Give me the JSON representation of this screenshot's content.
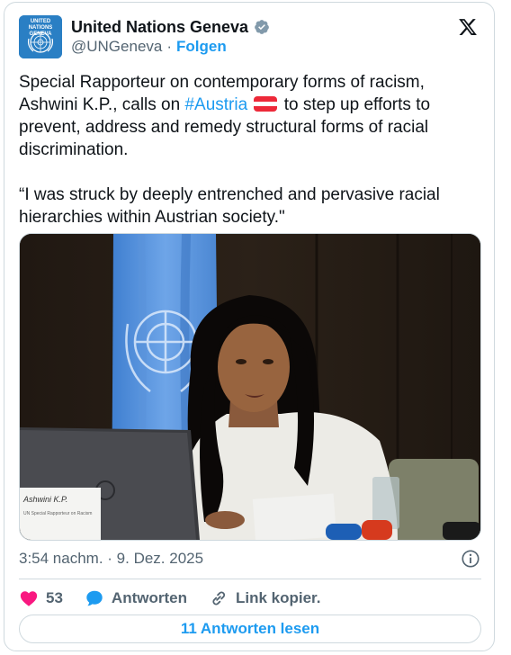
{
  "author": {
    "display_name": "United Nations Geneva",
    "handle": "@UNGeneva",
    "separator": "·",
    "follow_label": "Folgen",
    "avatar_text": "UNITED NATIONS GENEVA",
    "verified_color": "#829aab"
  },
  "tweet": {
    "text_part1": "Special Rapporteur on contemporary forms of racism, Ashwini K.P., calls on ",
    "hashtag": "#Austria",
    "text_part2": " to step up efforts to prevent, address and remedy structural forms of racial discrimination.\n\n“I was struck by deeply entrenched and pervasive racial hierarchies within Austrian society.\"",
    "flag_emoji": "austria-flag-emoji"
  },
  "photo": {
    "nameplate_line1": "Ashwini K.P.",
    "nameplate_line2": "UN Special Rapporteur on Racism",
    "laptop_logo": "hp"
  },
  "meta": {
    "timestamp": "3:54 nachm. · 9. Dez. 2025"
  },
  "actions": {
    "like_count": "53",
    "reply_label": "Antworten",
    "copy_link_label": "Link kopier."
  },
  "read_replies_label": "11 Antworten lesen",
  "colors": {
    "accent": "#1d9bf0",
    "like": "#f91880",
    "text": "#0f1419",
    "secondary": "#536471",
    "border": "#cfd9de"
  }
}
